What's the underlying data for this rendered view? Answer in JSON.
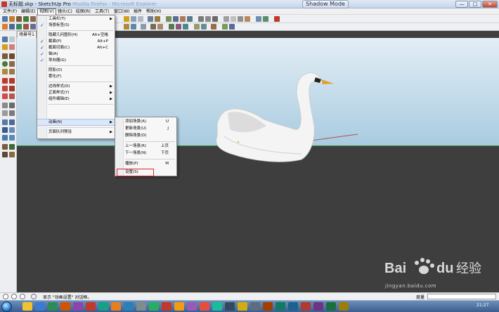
{
  "window": {
    "title": "无标题.skp - SketchUp Pro",
    "title_faded": "  Mozilla Firefox - Microsoft Explorer",
    "shadow_mode": "Shadow Mode",
    "min": "—",
    "max": "□",
    "close": "✕"
  },
  "menubar": {
    "items": [
      "文件(F)",
      "编辑(E)",
      "视图(V)",
      "镜头(C)",
      "绘图(R)",
      "工具(T)",
      "窗口(W)",
      "插件",
      "帮助(H)"
    ],
    "active_index": 2
  },
  "scene_tab": "场景号1",
  "view_menu": {
    "items": [
      {
        "label": "工具栏(T)",
        "checked": false,
        "submenu": true
      },
      {
        "label": "场景标签(S)",
        "checked": true
      },
      {
        "label": "隐藏几何图形(H)",
        "shortcut": "Alt+空格"
      },
      {
        "label": "截面(P)",
        "checked": true,
        "shortcut": "Alt+P"
      },
      {
        "label": "截面切面(C)",
        "checked": true,
        "shortcut": "Alt+C"
      },
      {
        "label": "轴(A)",
        "checked": true
      },
      {
        "label": "导向器(G)",
        "checked": true
      },
      {
        "label": "阴影(D)"
      },
      {
        "label": "雾化(F)"
      },
      {
        "label": "边线样式(D)",
        "submenu": true
      },
      {
        "label": "正面样式(Y)",
        "submenu": true
      },
      {
        "label": "组件编辑(E)",
        "submenu": true
      },
      {
        "label": "动画(N)",
        "submenu": true,
        "highlighted": true
      },
      {
        "label": "页面队列预设",
        "submenu": true
      }
    ]
  },
  "anim_menu": {
    "items": [
      {
        "label": "添加场景(A)",
        "shortcut": "U"
      },
      {
        "label": "更新场景(U)",
        "shortcut": "J"
      },
      {
        "label": "删除场景(D)"
      },
      {
        "label": "上一场景(R)",
        "shortcut": "上页"
      },
      {
        "label": "下一场景(N)",
        "shortcut": "下页"
      },
      {
        "label": "播放(P)",
        "shortcut": "M"
      },
      {
        "label": "设置(S)",
        "boxed": true
      }
    ]
  },
  "statusbar": {
    "text": "显示 \"动画设置\" 对话框。",
    "measure_label": "度量"
  },
  "taskbar": {
    "clock": "21:27"
  },
  "watermark": {
    "text": "jingyan.baidu.com",
    "brand": "Bai du 经验"
  },
  "colors": {
    "sky_top": "#e3eef6",
    "sky_bottom": "#a9cbe0",
    "ground": "#3e3e3e",
    "highlight": "#dbe7f7",
    "callout_red": "#e0202a"
  }
}
